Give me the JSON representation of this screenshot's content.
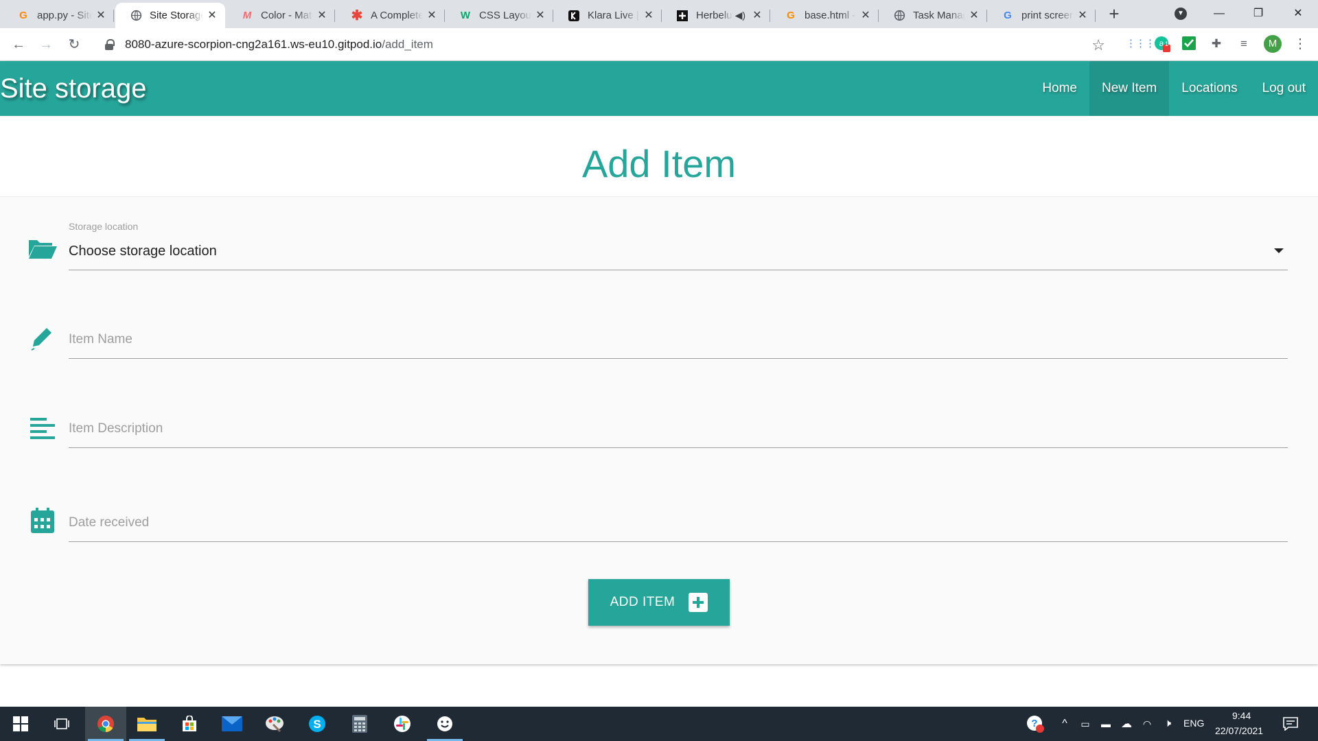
{
  "browser": {
    "tabs": [
      {
        "title": "app.py - Site Storage",
        "favicon": "gitpod-icon",
        "favicon_color": "#ff8a00",
        "active": false
      },
      {
        "title": "Site Storage",
        "favicon": "globe-icon",
        "favicon_color": "#5f6368",
        "active": true
      },
      {
        "title": "Color - Materialize",
        "favicon": "materialize-icon",
        "favicon_color": "#ee6e73",
        "active": false
      },
      {
        "title": "A Complete Guide",
        "favicon": "asterisk-icon",
        "favicon_color": "#e8453c",
        "active": false
      },
      {
        "title": "CSS Layout",
        "favicon": "w3schools-icon",
        "favicon_color": "#04aa6d",
        "active": false
      },
      {
        "title": "Klara Live | Klara",
        "favicon": "klara-icon",
        "favicon_color": "#111111",
        "active": false
      },
      {
        "title": "Herbeluxe",
        "favicon": "plus-square-icon",
        "favicon_color": "#111111",
        "active": false,
        "muted": true
      },
      {
        "title": "base.html - Site",
        "favicon": "gitpod-icon",
        "favicon_color": "#ff8a00",
        "active": false
      },
      {
        "title": "Task Manager",
        "favicon": "globe-icon",
        "favicon_color": "#5f6368",
        "active": false
      },
      {
        "title": "print screen",
        "favicon": "google-icon",
        "favicon_color": "#4285f4",
        "active": false
      }
    ],
    "url_host": "8080-azure-scorpion-cng2a161.ws-eu10.gitpod.io",
    "url_path": "/add_item",
    "profile_initial": "M",
    "extension_badge": "1"
  },
  "site": {
    "brand": "Site storage",
    "nav": [
      {
        "label": "Home",
        "active": false
      },
      {
        "label": "New Item",
        "active": true
      },
      {
        "label": "Locations",
        "active": false
      },
      {
        "label": "Log out",
        "active": false
      }
    ]
  },
  "page": {
    "title": "Add Item",
    "form": {
      "location_label": "Storage location",
      "location_value": "Choose storage location",
      "item_name_placeholder": "Item Name",
      "item_description_placeholder": "Item Description",
      "date_received_placeholder": "Date received",
      "submit_label": "ADD ITEM"
    }
  },
  "taskbar": {
    "language": "ENG",
    "time": "9:44",
    "date": "22/07/2021"
  },
  "colors": {
    "accent": "#26a69a",
    "taskbar": "#1f2a35"
  }
}
